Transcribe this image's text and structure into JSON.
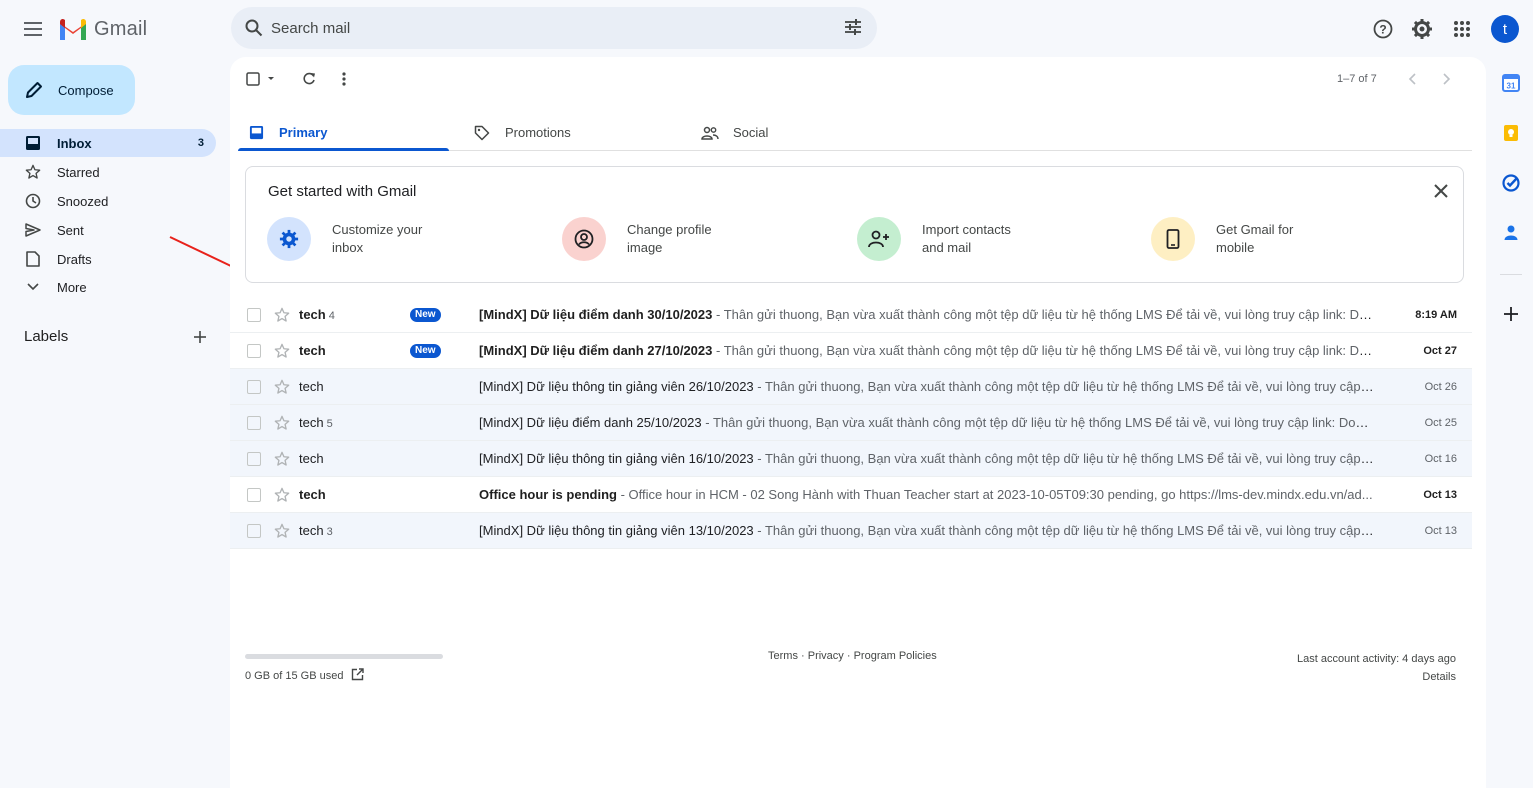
{
  "app": {
    "name": "Gmail",
    "brand_color": "#0b57d0"
  },
  "header": {
    "search_placeholder": "Search mail",
    "avatar_letter": "t"
  },
  "sidebar": {
    "compose_label": "Compose",
    "items": [
      {
        "label": "Inbox",
        "count": "3",
        "icon": "inbox-icon",
        "active": true
      },
      {
        "label": "Starred",
        "icon": "star-icon"
      },
      {
        "label": "Snoozed",
        "icon": "clock-icon"
      },
      {
        "label": "Sent",
        "icon": "send-icon"
      },
      {
        "label": "Drafts",
        "icon": "draft-icon"
      },
      {
        "label": "More",
        "icon": "chevron-down-icon"
      }
    ],
    "labels_heading": "Labels"
  },
  "toolbar": {
    "pager": "1–7 of 7"
  },
  "tabs": [
    {
      "label": "Primary",
      "icon": "inbox-icon",
      "active": true
    },
    {
      "label": "Promotions",
      "icon": "tag-icon"
    },
    {
      "label": "Social",
      "icon": "people-icon"
    }
  ],
  "get_started": {
    "title": "Get started with Gmail",
    "items": [
      {
        "line1": "Customize your",
        "line2": "inbox",
        "icon": "gear-icon",
        "bg": "#d3e3fd",
        "fg": "#0b57d0"
      },
      {
        "line1": "Change profile",
        "line2": "image",
        "icon": "account-icon",
        "bg": "#fad2cf",
        "fg": "#202124"
      },
      {
        "line1": "Import contacts",
        "line2": "and mail",
        "icon": "person-add-icon",
        "bg": "#c4eed0",
        "fg": "#202124"
      },
      {
        "line1": "Get Gmail for",
        "line2": "mobile",
        "icon": "phone-icon",
        "bg": "#feefc3",
        "fg": "#202124"
      }
    ]
  },
  "emails": [
    {
      "sender": "tech",
      "count": "4",
      "badge": "New",
      "subject": "[MindX] Dữ liệu điểm danh 30/10/2023",
      "snippet": " - Thân gửi thuong, Bạn vừa xuất thành công một tệp dữ liệu từ hệ thống LMS Để tải về, vui lòng truy cập link: Do...",
      "date": "8:19 AM",
      "unread": true
    },
    {
      "sender": "tech",
      "count": "",
      "badge": "New",
      "subject": "[MindX] Dữ liệu điểm danh 27/10/2023",
      "snippet": " - Thân gửi thuong, Bạn vừa xuất thành công một tệp dữ liệu từ hệ thống LMS Để tải về, vui lòng truy cập link: Dow...",
      "date": "Oct 27",
      "unread": true
    },
    {
      "sender": "tech",
      "count": "",
      "badge": "",
      "subject": "[MindX] Dữ liệu thông tin giảng viên 26/10/2023",
      "snippet": " - Thân gửi thuong, Bạn vừa xuất thành công một tệp dữ liệu từ hệ thống LMS Để tải về, vui lòng truy cập lin...",
      "date": "Oct 26",
      "unread": false
    },
    {
      "sender": "tech",
      "count": "5",
      "badge": "",
      "subject": "[MindX] Dữ liệu điểm danh 25/10/2023",
      "snippet": " - Thân gửi thuong, Bạn vừa xuất thành công một tệp dữ liệu từ hệ thống LMS Để tải về, vui lòng truy cập link: DownL...",
      "date": "Oct 25",
      "unread": false
    },
    {
      "sender": "tech",
      "count": "",
      "badge": "",
      "subject": "[MindX] Dữ liệu thông tin giảng viên 16/10/2023",
      "snippet": " - Thân gửi thuong, Bạn vừa xuất thành công một tệp dữ liệu từ hệ thống LMS Để tải về, vui lòng truy cập lin...",
      "date": "Oct 16",
      "unread": false
    },
    {
      "sender": "tech",
      "count": "",
      "badge": "",
      "subject": "Office hour is pending",
      "snippet": " - Office hour in HCM - 02 Song Hành with Thuan Teacher start at 2023-10-05T09:30 pending, go https://lms-dev.mindx.edu.vn/ad...",
      "date": "Oct 13",
      "unread": true
    },
    {
      "sender": "tech",
      "count": "3",
      "badge": "",
      "subject": "[MindX] Dữ liệu thông tin giảng viên 13/10/2023",
      "snippet": " - Thân gửi thuong, Bạn vừa xuất thành công một tệp dữ liệu từ hệ thống LMS Để tải về, vui lòng truy cập lin...",
      "date": "Oct 13",
      "unread": false
    }
  ],
  "footer": {
    "storage": "0 GB of 15 GB used",
    "storage_fraction": 0,
    "terms": "Terms",
    "privacy": "Privacy",
    "policies": "Program Policies",
    "sep": " · ",
    "activity": "Last account activity: 4 days ago",
    "details": "Details"
  },
  "side_panel": [
    "calendar-icon",
    "keep-icon",
    "tasks-icon",
    "contacts-icon",
    "add-icon"
  ]
}
